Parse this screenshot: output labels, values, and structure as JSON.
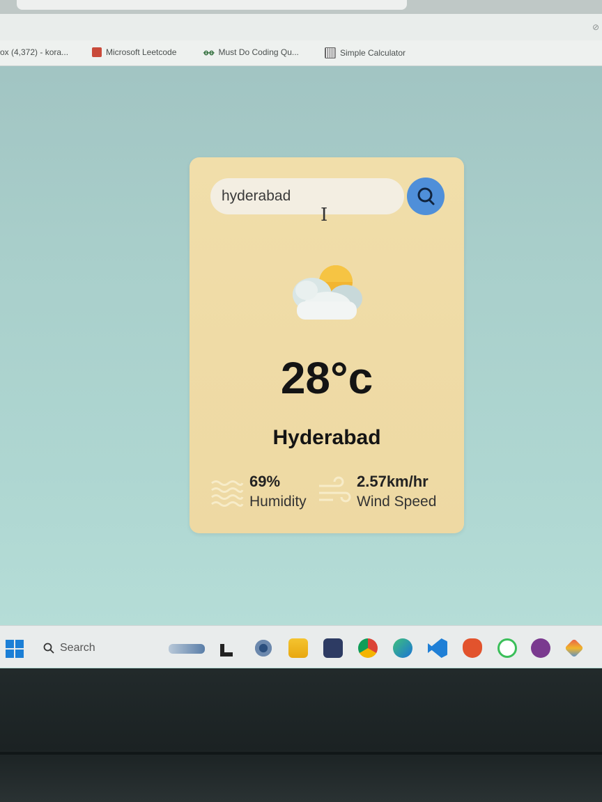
{
  "bookmarks": [
    {
      "label": "ox (4,372) - kora..."
    },
    {
      "label": "Microsoft Leetcode"
    },
    {
      "label": "Must Do Coding Qu..."
    },
    {
      "label": "Simple Calculator"
    }
  ],
  "weather": {
    "search_value": "hyderabad",
    "temperature": "28°c",
    "city": "Hyderabad",
    "humidity_value": "69%",
    "humidity_label": "Humidity",
    "wind_value": "2.57km/hr",
    "wind_label": "Wind Speed",
    "icon": "partly-cloudy-icon",
    "colors": {
      "card": "#f1deaa",
      "search_button": "#4f8fd9"
    }
  },
  "taskbar": {
    "search_label": "Search"
  }
}
